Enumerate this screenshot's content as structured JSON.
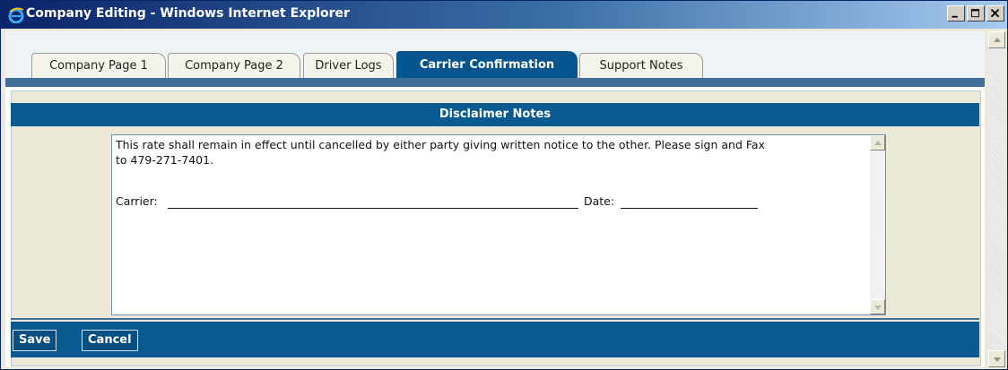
{
  "window": {
    "title": "Company Editing - Windows Internet Explorer",
    "icon": "ie-logo-icon",
    "controls": [
      "minimize-icon",
      "maximize-icon",
      "close-icon"
    ]
  },
  "tabs": [
    {
      "label": "Company Page 1",
      "active": false
    },
    {
      "label": "Company Page 2",
      "active": false
    },
    {
      "label": "Driver Logs",
      "active": false
    },
    {
      "label": "Carrier Confirmation",
      "active": true
    },
    {
      "label": "Support Notes",
      "active": false
    }
  ],
  "panel": {
    "header": "Disclaimer Notes",
    "notes_line1": "This rate shall remain in effect until cancelled by either party giving written notice to the other. Please sign and Fax",
    "notes_line2": "to 479-271-7401.",
    "carrier_label": "Carrier:",
    "date_label": "Date:"
  },
  "footer": {
    "save_label": "Save",
    "cancel_label": "Cancel"
  },
  "colors": {
    "accent": "#0a5a92",
    "tab_active": "#06558f",
    "titlebar_start": "#0a246a"
  }
}
